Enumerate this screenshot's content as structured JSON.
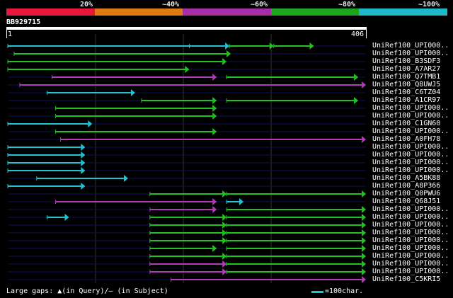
{
  "legend": {
    "labels": [
      "20%",
      "~40%",
      "~60%",
      "~80%",
      "~100%"
    ],
    "colors": [
      "#e8183c",
      "#e07a12",
      "#a62fa6",
      "#1ea51e",
      "#1fb8c8"
    ]
  },
  "query": {
    "name": "BB929715",
    "start": "1",
    "end": "406",
    "length": 406
  },
  "hits": [
    {
      "label": "UniRef100_UPI000..",
      "segments": [
        {
          "s": 1,
          "e": 259,
          "c": "#1fc3d3",
          "arrow": false
        },
        {
          "s": 259,
          "e": 316,
          "c": "#1fc3d3",
          "arrow": true
        },
        {
          "s": 316,
          "e": 379,
          "c": "#22c122",
          "arrow": true
        },
        {
          "s": 379,
          "e": 436,
          "c": "#22c122",
          "arrow": true
        }
      ]
    },
    {
      "label": "UniRef100_UPI000..",
      "segments": [
        {
          "s": 10,
          "e": 318,
          "c": "#22c122",
          "arrow": true
        }
      ]
    },
    {
      "label": "UniRef100_B3SDF3",
      "segments": [
        {
          "s": 1,
          "e": 312,
          "c": "#22c122",
          "arrow": true
        }
      ]
    },
    {
      "label": "UniRef100_A7AR27",
      "segments": [
        {
          "s": 1,
          "e": 259,
          "c": "#22c122",
          "arrow": true
        }
      ]
    },
    {
      "label": "UniRef100_Q7TMB1",
      "segments": [
        {
          "s": 64,
          "e": 298,
          "c": "#b03cb8",
          "arrow": true
        },
        {
          "s": 312,
          "e": 499,
          "c": "#22c122",
          "arrow": true
        }
      ]
    },
    {
      "label": "UniRef100_Q8UWJ5",
      "segments": [
        {
          "s": 18,
          "e": 510,
          "c": "#b03cb8",
          "arrow": true
        }
      ]
    },
    {
      "label": "UniRef100_C6TZ04",
      "segments": [
        {
          "s": 57,
          "e": 182,
          "c": "#1fc3d3",
          "arrow": true
        }
      ]
    },
    {
      "label": "UniRef100_A1CR97",
      "segments": [
        {
          "s": 191,
          "e": 298,
          "c": "#22c122",
          "arrow": true
        },
        {
          "s": 312,
          "e": 499,
          "c": "#22c122",
          "arrow": true
        }
      ]
    },
    {
      "label": "UniRef100_UPI000..",
      "segments": [
        {
          "s": 69,
          "e": 298,
          "c": "#22c122",
          "arrow": true
        }
      ]
    },
    {
      "label": "UniRef100_UPI000..",
      "segments": [
        {
          "s": 69,
          "e": 298,
          "c": "#22c122",
          "arrow": true
        }
      ]
    },
    {
      "label": "UniRef100_C1GN60",
      "segments": [
        {
          "s": 1,
          "e": 121,
          "c": "#1fc3d3",
          "arrow": true
        }
      ]
    },
    {
      "label": "UniRef100_UPI000..",
      "segments": [
        {
          "s": 69,
          "e": 298,
          "c": "#22c122",
          "arrow": true
        }
      ]
    },
    {
      "label": "UniRef100_A0FH78",
      "segments": [
        {
          "s": 76,
          "e": 510,
          "c": "#b03cb8",
          "arrow": true
        }
      ]
    },
    {
      "label": "UniRef100_UPI000..",
      "segments": [
        {
          "s": 1,
          "e": 111,
          "c": "#1fc3d3",
          "arrow": true
        }
      ]
    },
    {
      "label": "UniRef100_UPI000..",
      "segments": [
        {
          "s": 1,
          "e": 111,
          "c": "#1fc3d3",
          "arrow": true
        }
      ]
    },
    {
      "label": "UniRef100_UPI000..",
      "segments": [
        {
          "s": 1,
          "e": 111,
          "c": "#1fc3d3",
          "arrow": true
        }
      ]
    },
    {
      "label": "UniRef100_UPI000..",
      "segments": [
        {
          "s": 1,
          "e": 111,
          "c": "#1fc3d3",
          "arrow": true
        }
      ]
    },
    {
      "label": "UniRef100_A5BK88",
      "segments": [
        {
          "s": 42,
          "e": 172,
          "c": "#1fc3d3",
          "arrow": true
        }
      ]
    },
    {
      "label": "UniRef100_A8P366",
      "segments": [
        {
          "s": 1,
          "e": 111,
          "c": "#1fc3d3",
          "arrow": true
        }
      ]
    },
    {
      "label": "UniRef100_Q0PWU6",
      "segments": [
        {
          "s": 203,
          "e": 312,
          "c": "#22c122",
          "arrow": true
        },
        {
          "s": 312,
          "e": 510,
          "c": "#22c122",
          "arrow": true
        }
      ]
    },
    {
      "label": "UniRef100_Q68J51",
      "segments": [
        {
          "s": 69,
          "e": 298,
          "c": "#b03cb8",
          "arrow": true
        },
        {
          "s": 312,
          "e": 336,
          "c": "#1fc3d3",
          "arrow": true
        }
      ]
    },
    {
      "label": "UniRef100_UPI000..",
      "segments": [
        {
          "s": 203,
          "e": 298,
          "c": "#b03cb8",
          "arrow": true
        },
        {
          "s": 312,
          "e": 510,
          "c": "#22c122",
          "arrow": true
        }
      ]
    },
    {
      "label": "UniRef100_UPI000..",
      "segments": [
        {
          "s": 57,
          "e": 88,
          "c": "#1fc3d3",
          "arrow": true
        },
        {
          "s": 203,
          "e": 312,
          "c": "#22c122",
          "arrow": true
        },
        {
          "s": 312,
          "e": 510,
          "c": "#22c122",
          "arrow": true
        }
      ]
    },
    {
      "label": "UniRef100_UPI000..",
      "segments": [
        {
          "s": 203,
          "e": 312,
          "c": "#22c122",
          "arrow": true
        },
        {
          "s": 312,
          "e": 510,
          "c": "#22c122",
          "arrow": true
        }
      ]
    },
    {
      "label": "UniRef100_UPI000..",
      "segments": [
        {
          "s": 203,
          "e": 312,
          "c": "#22c122",
          "arrow": true
        },
        {
          "s": 312,
          "e": 510,
          "c": "#22c122",
          "arrow": true
        }
      ]
    },
    {
      "label": "UniRef100_UPI000..",
      "segments": [
        {
          "s": 203,
          "e": 312,
          "c": "#22c122",
          "arrow": true
        },
        {
          "s": 312,
          "e": 510,
          "c": "#22c122",
          "arrow": true
        }
      ]
    },
    {
      "label": "UniRef100_UPI000..",
      "segments": [
        {
          "s": 203,
          "e": 298,
          "c": "#22c122",
          "arrow": true
        },
        {
          "s": 312,
          "e": 510,
          "c": "#22c122",
          "arrow": true
        }
      ]
    },
    {
      "label": "UniRef100_UPI000..",
      "segments": [
        {
          "s": 203,
          "e": 312,
          "c": "#22c122",
          "arrow": true
        },
        {
          "s": 312,
          "e": 510,
          "c": "#22c122",
          "arrow": true
        }
      ]
    },
    {
      "label": "UniRef100_UPI000..",
      "segments": [
        {
          "s": 203,
          "e": 312,
          "c": "#b03cb8",
          "arrow": true
        },
        {
          "s": 312,
          "e": 510,
          "c": "#22c122",
          "arrow": true
        }
      ]
    },
    {
      "label": "UniRef100_UPI000..",
      "segments": [
        {
          "s": 203,
          "e": 312,
          "c": "#b03cb8",
          "arrow": true
        },
        {
          "s": 312,
          "e": 510,
          "c": "#22c122",
          "arrow": true
        }
      ]
    },
    {
      "label": "UniRef100_C5KRI5",
      "segments": [
        {
          "s": 233,
          "e": 510,
          "c": "#b03cb8",
          "arrow": true
        }
      ]
    }
  ],
  "footer": {
    "gaps_text": "Large gaps: ▲(in Query)/— (in Subject)",
    "scale_text": "=100char."
  }
}
